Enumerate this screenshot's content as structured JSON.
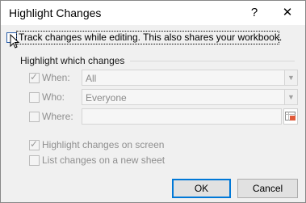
{
  "window": {
    "title": "Highlight Changes",
    "help_glyph": "?",
    "close_glyph": "✕"
  },
  "track": {
    "label": "Track changes while editing. This also shares your workbook.",
    "checked": false
  },
  "group": {
    "title": "Highlight which changes"
  },
  "when": {
    "label": "When:",
    "checked": true,
    "value": "All"
  },
  "who": {
    "label": "Who:",
    "checked": false,
    "value": "Everyone"
  },
  "where": {
    "label": "Where:",
    "checked": false,
    "value": ""
  },
  "options": {
    "on_screen": {
      "label": "Highlight changes on screen",
      "checked": true
    },
    "new_sheet": {
      "label": "List changes on a new sheet",
      "checked": false
    }
  },
  "buttons": {
    "ok": "OK",
    "cancel": "Cancel"
  },
  "icons": {
    "help": "help-icon",
    "close": "close-icon",
    "dropdown": "chevron-down-icon",
    "range": "range-select-icon",
    "cursor": "mouse-pointer-icon"
  },
  "colors": {
    "accent": "#0078d7",
    "disabled_text": "#8f8f8f"
  }
}
